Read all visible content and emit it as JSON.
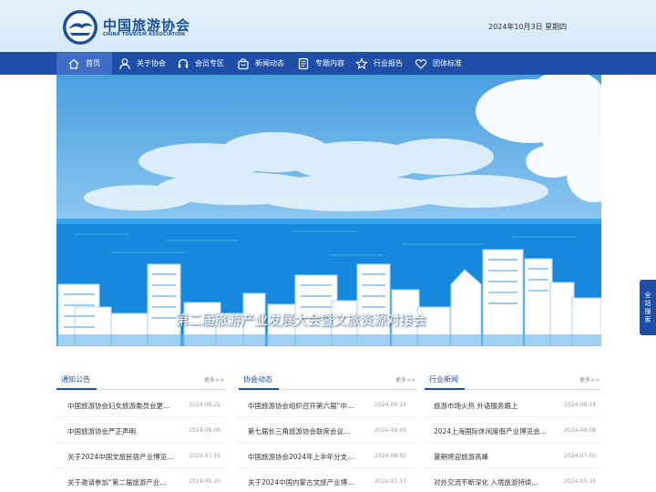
{
  "header": {
    "logo_cn": "中国旅游协会",
    "logo_en": "CHINA TOURISM ASSOCIATION",
    "emblem_text": "C.T.A",
    "date": "2024年10月3日 星期四"
  },
  "nav": {
    "items": [
      {
        "label": "首页",
        "icon": "home-icon"
      },
      {
        "label": "关于协会",
        "icon": "user-icon"
      },
      {
        "label": "会员专区",
        "icon": "headset-icon"
      },
      {
        "label": "新闻动态",
        "icon": "bag-icon"
      },
      {
        "label": "专题内容",
        "icon": "document-icon"
      },
      {
        "label": "行业报告",
        "icon": "star-icon"
      },
      {
        "label": "团体标准",
        "icon": "heart-icon"
      }
    ]
  },
  "banner": {
    "caption": "第二届旅游产业发展大会暨文旅资源对接会"
  },
  "side_float": {
    "label_chars": [
      "全",
      "站",
      "搜",
      "索"
    ]
  },
  "panels": [
    {
      "title": "通知公告",
      "more": "更多>>",
      "items": [
        {
          "title": "中国旅游协会妇女旅游委员会更…",
          "date": "2024-08-22"
        },
        {
          "title": "中国旅游协会严正声明",
          "date": "2024-08-06"
        },
        {
          "title": "关于2024中国文旅民宿产业博览…",
          "date": "2024-07-15"
        },
        {
          "title": "关于邀请参加“第二届旅游产业…",
          "date": "2024-06-20"
        }
      ]
    },
    {
      "title": "协会动态",
      "more": "更多>>",
      "items": [
        {
          "title": "中国旅游协会组织召开第六届“中…",
          "date": "2024-09-19"
        },
        {
          "title": "第七届长三角旅游协会联席会议…",
          "date": "2024-09-09"
        },
        {
          "title": "中国旅游协会2024年上半年分支…",
          "date": "2024-08-02"
        },
        {
          "title": "关于2024中国内蒙古文旅产业博…",
          "date": "2024-07-17"
        }
      ]
    },
    {
      "title": "行业新闻",
      "more": "更多>>",
      "items": [
        {
          "title": "旅游市场火热 外语服务跟上",
          "date": "2024-08-14"
        },
        {
          "title": "2024上海国际休闲度假产业博览会…",
          "date": "2024-08-08"
        },
        {
          "title": "暑期将迎旅游高峰",
          "date": "2024-07-05"
        },
        {
          "title": "对外交流不断深化 入境旅游持续…",
          "date": "2024-05-16"
        }
      ]
    }
  ],
  "colors": {
    "brand_blue": "#1d4fa8",
    "nav_active": "#3f6cc4",
    "header_bg": "#dcecf9"
  }
}
